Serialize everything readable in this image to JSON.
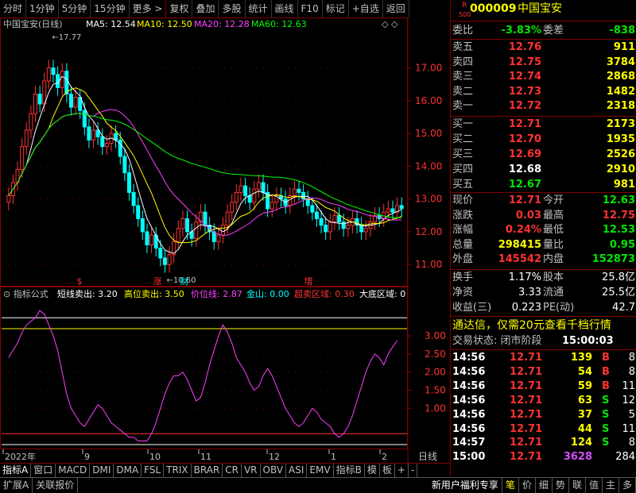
{
  "toolbar": {
    "items": [
      "分时",
      "1分钟",
      "5分钟",
      "15分钟",
      "更多 >",
      "复权",
      "叠加",
      "多股",
      "统计",
      "画线",
      "F10",
      "标记",
      "+自选",
      "返回"
    ]
  },
  "chart_header": {
    "stock_label": "中国宝安(日线)",
    "ma5": "MA5: 12.54",
    "ma10": "MA10: 12.50",
    "ma20": "MA20: 12.28",
    "ma60": "MA60: 12.63"
  },
  "annotations": {
    "high_label": "17.77",
    "low_label": "10.60",
    "markers": [
      "$",
      "涨",
      "财",
      "增"
    ]
  },
  "indicator_header": {
    "title": "指标公式",
    "s1": "短线卖出: 3.20",
    "s2": "高位卖出: 3.50",
    "s3": "价位线: 2.87",
    "s4": "金山: 0.00",
    "s5": "超卖区域: 0.30",
    "s6": "大底区域: 0"
  },
  "x_axis": {
    "labels": [
      "2022年",
      "9",
      "10",
      "11",
      "12",
      "1",
      "2"
    ],
    "period_label": "日线"
  },
  "chart_data": [
    {
      "type": "candlestick",
      "ylim": [
        10.4,
        18.2
      ],
      "y_ticks": [
        "17.00",
        "16.00",
        "15.00",
        "14.00",
        "13.00",
        "12.00",
        "11.00"
      ],
      "close": [
        13.1,
        13.5,
        13.9,
        14.6,
        15.1,
        15.6,
        16.2,
        15.9,
        16.6,
        17.0,
        16.8,
        16.4,
        16.9,
        16.2,
        15.8,
        16.1,
        15.7,
        15.2,
        14.8,
        15.1,
        14.9,
        14.6,
        14.7,
        15.0,
        14.8,
        14.3,
        13.8,
        13.2,
        12.8,
        12.4,
        12.0,
        11.6,
        11.9,
        11.5,
        11.2,
        11.0,
        11.3,
        11.7,
        12.1,
        12.4,
        12.0,
        11.8,
        12.3,
        12.6,
        12.2,
        12.0,
        11.7,
        11.9,
        12.2,
        12.6,
        12.9,
        13.2,
        13.4,
        13.1,
        12.9,
        13.3,
        13.5,
        13.2,
        12.7,
        12.9,
        13.1,
        13.0,
        12.8,
        13.1,
        13.3,
        13.2,
        13.0,
        12.8,
        12.6,
        12.4,
        12.2,
        12.0,
        12.3,
        12.5,
        12.3,
        12.1,
        12.2,
        12.4,
        12.2,
        12.0,
        12.1,
        12.3,
        12.5,
        12.4,
        12.6,
        12.7,
        12.6,
        12.8,
        12.71
      ],
      "ma_series": [
        "MA5",
        "MA10",
        "MA20",
        "MA60"
      ],
      "colors": {
        "up": "#ff3232",
        "down": "#00ffff",
        "ma5": "#ffffff",
        "ma10": "#ffff00",
        "ma20": "#ff40ff",
        "ma60": "#00ff00"
      }
    },
    {
      "type": "line",
      "name": "价位线",
      "ylim": [
        0,
        3.9
      ],
      "y_ticks": [
        "3.00",
        "2.50",
        "2.00",
        "1.50",
        "1.00"
      ],
      "reference_lines": {
        "高位卖出": 3.5,
        "短线卖出": 3.2,
        "超卖区域": 0.3,
        "金山": 0.0
      },
      "values": [
        2.4,
        2.6,
        2.8,
        3.1,
        3.3,
        3.4,
        3.5,
        3.7,
        3.6,
        3.3,
        3.0,
        2.6,
        2.0,
        1.4,
        1.0,
        0.8,
        0.6,
        0.5,
        0.7,
        0.9,
        1.1,
        1.0,
        0.8,
        0.6,
        0.5,
        0.4,
        0.3,
        0.2,
        0.2,
        0.1,
        0.1,
        0.1,
        0.3,
        0.6,
        1.0,
        1.4,
        1.7,
        1.9,
        1.9,
        2.0,
        1.8,
        1.5,
        1.2,
        1.3,
        1.7,
        2.2,
        2.6,
        3.0,
        3.3,
        3.1,
        2.8,
        2.4,
        2.2,
        2.0,
        1.7,
        1.5,
        1.6,
        1.9,
        2.1,
        1.9,
        1.6,
        1.3,
        1.0,
        0.8,
        0.6,
        0.5,
        0.6,
        0.8,
        1.0,
        0.9,
        0.7,
        0.6,
        0.5,
        0.3,
        0.2,
        0.3,
        0.5,
        0.8,
        1.2,
        1.6,
        2.0,
        2.3,
        2.5,
        2.4,
        2.2,
        2.5,
        2.7,
        2.87
      ],
      "color": "#ff40ff"
    }
  ],
  "quote": {
    "code": "000009",
    "name": "中国宝安",
    "badge_r": "R",
    "badge_num": "500",
    "weibi_label": "委比",
    "weibi_value": "-3.83%",
    "weicha_label": "委差",
    "weicha_value": "-838",
    "sells": [
      {
        "label": "卖五",
        "price": "12.76",
        "vol": "911"
      },
      {
        "label": "卖四",
        "price": "12.75",
        "vol": "3784"
      },
      {
        "label": "卖三",
        "price": "12.74",
        "vol": "2868"
      },
      {
        "label": "卖二",
        "price": "12.73",
        "vol": "1482"
      },
      {
        "label": "卖一",
        "price": "12.72",
        "vol": "2318"
      }
    ],
    "buys": [
      {
        "label": "买一",
        "price": "12.71",
        "vol": "2173"
      },
      {
        "label": "买二",
        "price": "12.70",
        "vol": "1935"
      },
      {
        "label": "买三",
        "price": "12.69",
        "vol": "2526"
      },
      {
        "label": "买四",
        "price": "12.68",
        "vol": "2910"
      },
      {
        "label": "买五",
        "price": "12.67",
        "vol": "981"
      }
    ],
    "stats": [
      {
        "l1": "现价",
        "v1": "12.71",
        "c1": "red",
        "l2": "今开",
        "v2": "12.63",
        "c2": "green"
      },
      {
        "l1": "涨跌",
        "v1": "0.03",
        "c1": "red",
        "l2": "最高",
        "v2": "12.75",
        "c2": "red"
      },
      {
        "l1": "涨幅",
        "v1": "0.24%",
        "c1": "red",
        "l2": "最低",
        "v2": "12.53",
        "c2": "green"
      },
      {
        "l1": "总量",
        "v1": "298415",
        "c1": "yellow",
        "l2": "量比",
        "v2": "0.95",
        "c2": "green"
      },
      {
        "l1": "外盘",
        "v1": "145542",
        "c1": "red",
        "l2": "内盘",
        "v2": "152873",
        "c2": "green"
      }
    ],
    "stats2": [
      {
        "l1": "换手",
        "v1": "1.17%",
        "l2": "股本",
        "v2": "25.8亿"
      },
      {
        "l1": "净资",
        "v1": "3.33",
        "l2": "流通",
        "v2": "25.5亿"
      },
      {
        "l1": "收益(三)",
        "v1": "0.223",
        "l2": "PE(动)",
        "v2": "42.7"
      }
    ],
    "promo": "通达信，仅需20元查看千档行情",
    "trade_state_label": "交易状态: 闭市阶段",
    "trade_state_time": "15:00:03",
    "ticks": [
      {
        "t": "14:56",
        "p": "12.71",
        "v": "139",
        "bs": "B",
        "n": "8"
      },
      {
        "t": "14:56",
        "p": "12.71",
        "v": "54",
        "bs": "B",
        "n": "8"
      },
      {
        "t": "14:56",
        "p": "12.71",
        "v": "59",
        "bs": "B",
        "n": "11"
      },
      {
        "t": "14:56",
        "p": "12.71",
        "v": "63",
        "bs": "S",
        "n": "12"
      },
      {
        "t": "14:56",
        "p": "12.71",
        "v": "37",
        "bs": "S",
        "n": "5"
      },
      {
        "t": "14:56",
        "p": "12.71",
        "v": "44",
        "bs": "S",
        "n": "11"
      },
      {
        "t": "14:57",
        "p": "12.71",
        "v": "124",
        "bs": "S",
        "n": "8"
      },
      {
        "t": "15:00",
        "p": "12.71",
        "v": "3628",
        "bs": "",
        "n": "284"
      }
    ]
  },
  "tabs": [
    "指标A",
    "窗口",
    "MACD",
    "DMI",
    "DMA",
    "FSL",
    "TRIX",
    "BRAR",
    "CR",
    "VR",
    "OBV",
    "ASI",
    "EMV",
    "指标B",
    "模",
    "板",
    "+",
    "-"
  ],
  "bottom_bar": [
    "扩展A",
    "关联报价",
    "新用户福利专享",
    "笔",
    "价",
    "细",
    "势",
    "联",
    "值",
    "主",
    "多"
  ]
}
